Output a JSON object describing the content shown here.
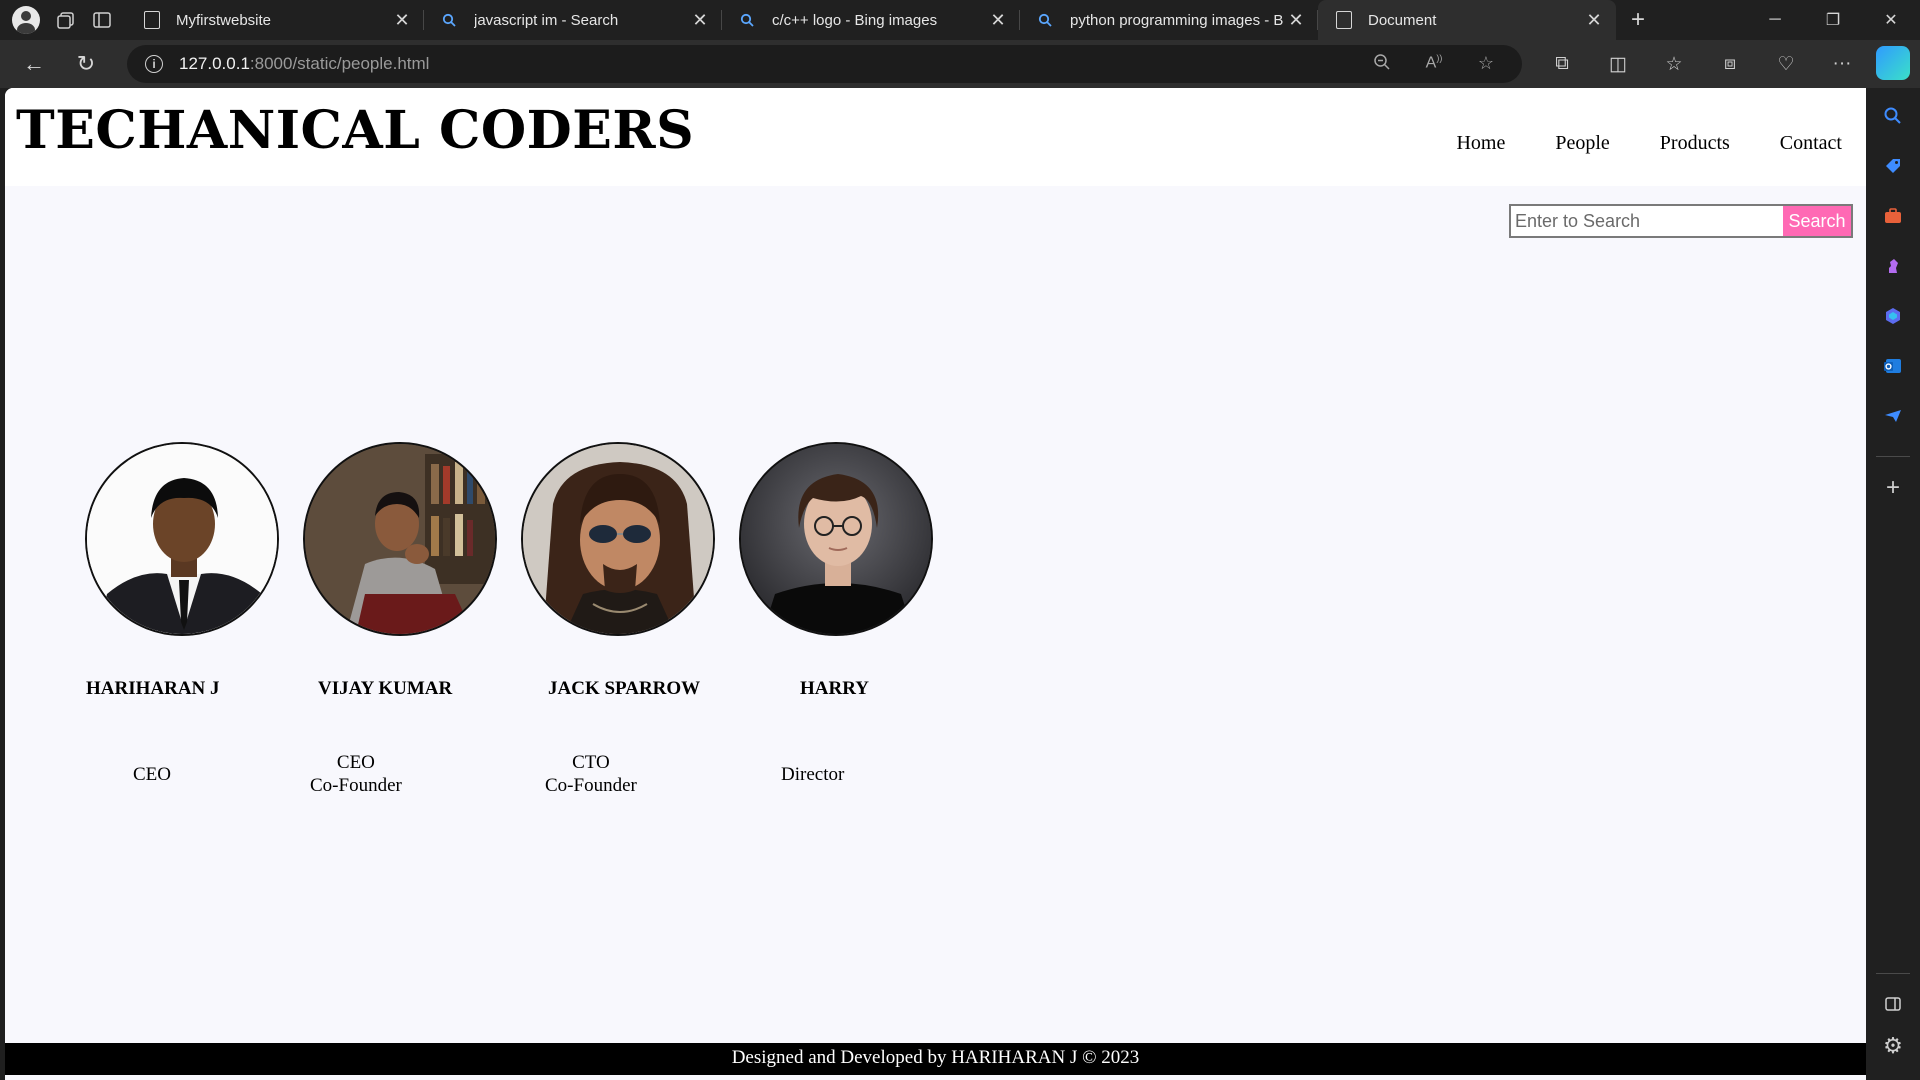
{
  "browser": {
    "tabs": [
      {
        "title": "Myfirstwebsite",
        "icon": "page-icon"
      },
      {
        "title": "javascript im - Search",
        "icon": "search-icon"
      },
      {
        "title": "c/c++ logo - Bing images",
        "icon": "search-icon"
      },
      {
        "title": "python programming images - B",
        "icon": "search-icon"
      },
      {
        "title": "Document",
        "icon": "page-icon",
        "active": true
      }
    ],
    "url_host": "127.0.0.1",
    "url_path": ":8000/static/people.html"
  },
  "site": {
    "title": "TECHANICAL CODERS",
    "nav": [
      "Home",
      "People",
      "Products",
      "Contact"
    ],
    "search_placeholder": "Enter to Search",
    "search_button": "Search",
    "accent_color": "#ff69b4",
    "people": [
      {
        "name": "HARIHARAN J",
        "role_line1": "CEO",
        "role_line2": ""
      },
      {
        "name": "VIJAY KUMAR",
        "role_line1": "CEO",
        "role_line2": "Co-Founder"
      },
      {
        "name": "JACK SPARROW",
        "role_line1": "CTO",
        "role_line2": "Co-Founder"
      },
      {
        "name": "HARRY",
        "role_line1": "Director",
        "role_line2": ""
      }
    ],
    "footer": "Designed and Developed by HARIHARAN J © 2023"
  }
}
